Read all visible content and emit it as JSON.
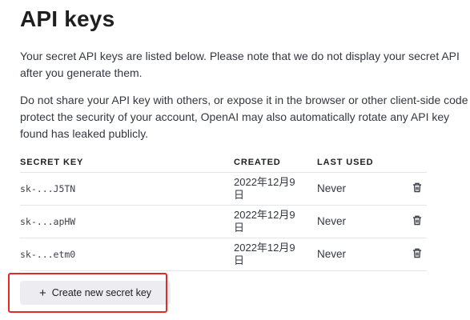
{
  "title": "API keys",
  "intro": {
    "line1": "Your secret API keys are listed below. Please note that we do not display your secret API",
    "line2": "after you generate them."
  },
  "warning": {
    "line1": "Do not share your API key with others, or expose it in the browser or other client-side code",
    "line2": "protect the security of your account, OpenAI may also automatically rotate any API key",
    "line3": "found has leaked publicly."
  },
  "table": {
    "headers": {
      "key": "SECRET KEY",
      "created": "CREATED",
      "last_used": "LAST USED"
    },
    "rows": [
      {
        "key": "sk-...J5TN",
        "created": "2022年12月9日",
        "last_used": "Never"
      },
      {
        "key": "sk-...apHW",
        "created": "2022年12月9日",
        "last_used": "Never"
      },
      {
        "key": "sk-...etm0",
        "created": "2022年12月9日",
        "last_used": "Never"
      }
    ],
    "row_action_icon": "trash-icon"
  },
  "create_button": {
    "icon": "+",
    "label": "Create new secret key"
  },
  "colors": {
    "highlight": "#e22a2a",
    "button_bg": "#ececf1"
  }
}
